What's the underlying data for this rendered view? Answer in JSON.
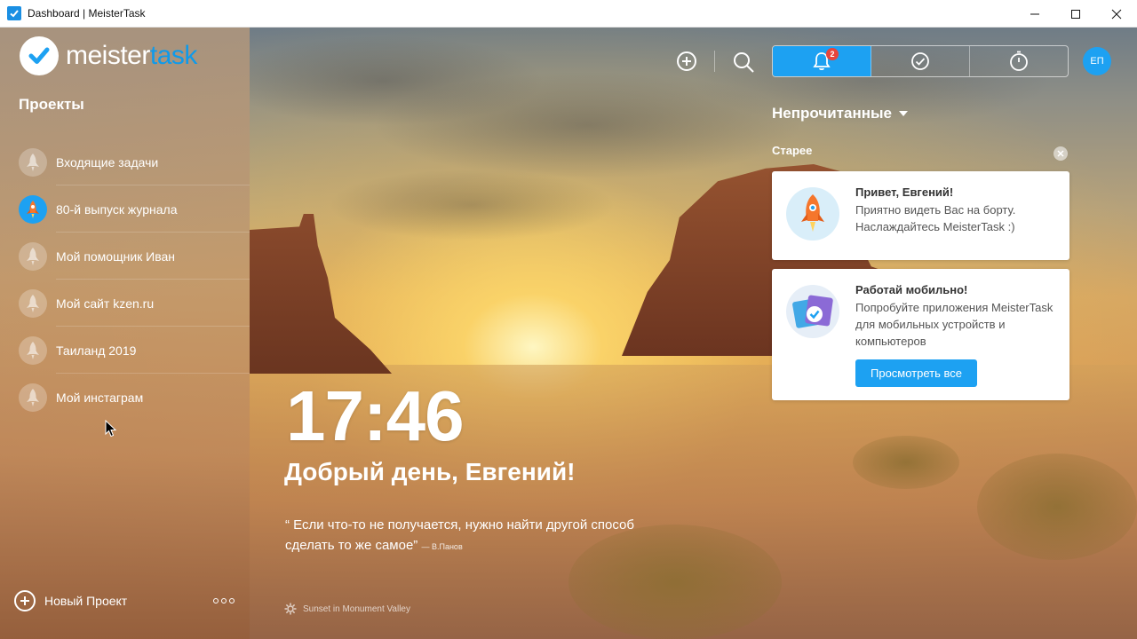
{
  "window": {
    "title": "Dashboard | MeisterTask"
  },
  "logo": {
    "part1": "meister",
    "part2": "task"
  },
  "sidebar": {
    "projects_title": "Проекты",
    "items": [
      {
        "label": "Входящие задачи",
        "active": false
      },
      {
        "label": "80-й выпуск журнала",
        "active": true
      },
      {
        "label": "Мой помощник Иван",
        "active": false
      },
      {
        "label": "Мой сайт kzen.ru",
        "active": false
      },
      {
        "label": "Таиланд 2019",
        "active": false
      },
      {
        "label": "Мой инстаграм",
        "active": false
      }
    ],
    "new_project_label": "Новый Проект"
  },
  "dashboard": {
    "time": "17:46",
    "greeting": "Добрый день, Евгений!",
    "quote": "“ Если что-то не получается, нужно найти другой способ сделать то же самое”",
    "quote_author": "— В.Панов",
    "photo_credit": "Sunset in Monument Valley"
  },
  "toolbar": {
    "notification_count": "2",
    "user_initials": "ЕП"
  },
  "notifications": {
    "filter_label": "Непрочитанные",
    "section_label": "Старее",
    "cards": [
      {
        "title": "Привет, Евгений!",
        "text": "Приятно видеть Вас на борту. Наслаждайтесь MeisterTask :)"
      },
      {
        "title": "Работай мобильно!",
        "text": "Попробуйте приложения MeisterTask для мобильных устройств и компьютеров",
        "button": "Просмотреть все"
      }
    ]
  },
  "colors": {
    "accent": "#1da1f2",
    "badge": "#e8453c"
  }
}
